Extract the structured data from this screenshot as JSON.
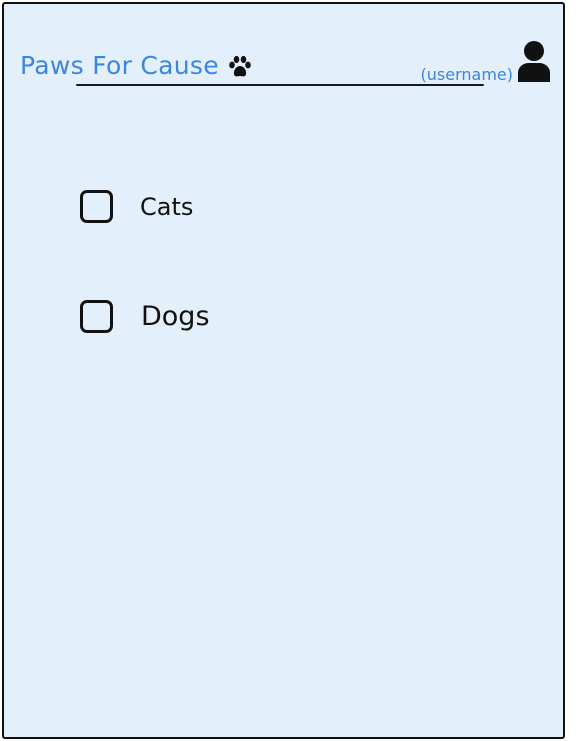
{
  "header": {
    "title": "Paws For Cause",
    "logo_icon": "paw-icon",
    "username": "(username)",
    "user_icon": "user-icon"
  },
  "options": [
    {
      "label": "Cats",
      "checked": false
    },
    {
      "label": "Dogs",
      "checked": false
    }
  ],
  "colors": {
    "background": "#e4effc",
    "accent": "#3b86de",
    "ink": "#111111"
  }
}
